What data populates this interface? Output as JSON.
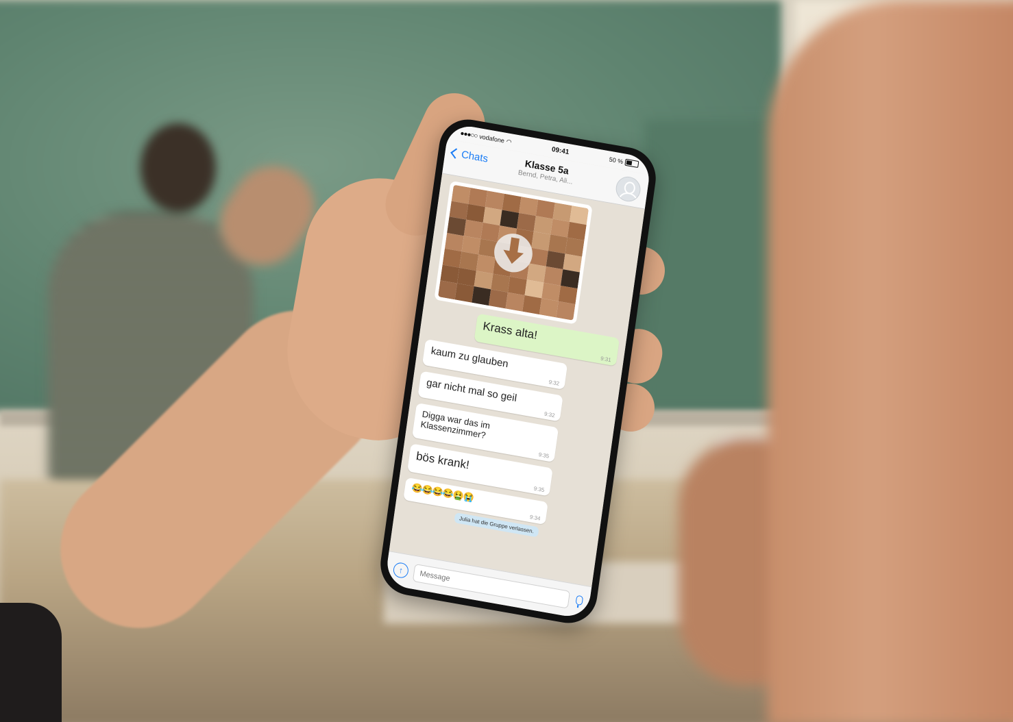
{
  "status_bar": {
    "carrier": "vodafone",
    "time": "09:41",
    "battery": "50 %"
  },
  "nav": {
    "back_label": "Chats",
    "title": "Klasse 5a",
    "subtitle": "Bernd, Petra, Ali..."
  },
  "messages": [
    {
      "direction": "out",
      "text": "Krass alta!",
      "time": "9:31"
    },
    {
      "direction": "in",
      "text": "kaum zu glauben",
      "time": "9:32"
    },
    {
      "direction": "in",
      "text": "gar nicht mal so geil",
      "time": "9:32"
    },
    {
      "direction": "in",
      "text": "Digga war das im Klassenzimmer?",
      "time": "9:35"
    },
    {
      "direction": "in",
      "text": "bös krank!",
      "time": "9:35"
    },
    {
      "direction": "in",
      "text": "😂😂😂😂🤮😭",
      "time": "9:34"
    }
  ],
  "system_notice": "Julia hat die Gruppe verlassen.",
  "composer": {
    "placeholder": "Message"
  },
  "icons": {
    "back": "chevron-left-icon",
    "avatar": "group-avatar-icon",
    "download": "download-arrow-icon",
    "attach": "attach-icon",
    "mic": "microphone-icon",
    "wifi": "wifi-icon",
    "battery": "battery-icon"
  },
  "colors": {
    "accent": "#1a7cf5",
    "outgoing_bubble": "#dcf5c6",
    "incoming_bubble": "#ffffff",
    "chat_background": "#e6e0d6",
    "system_notice": "#cfe6f4"
  }
}
